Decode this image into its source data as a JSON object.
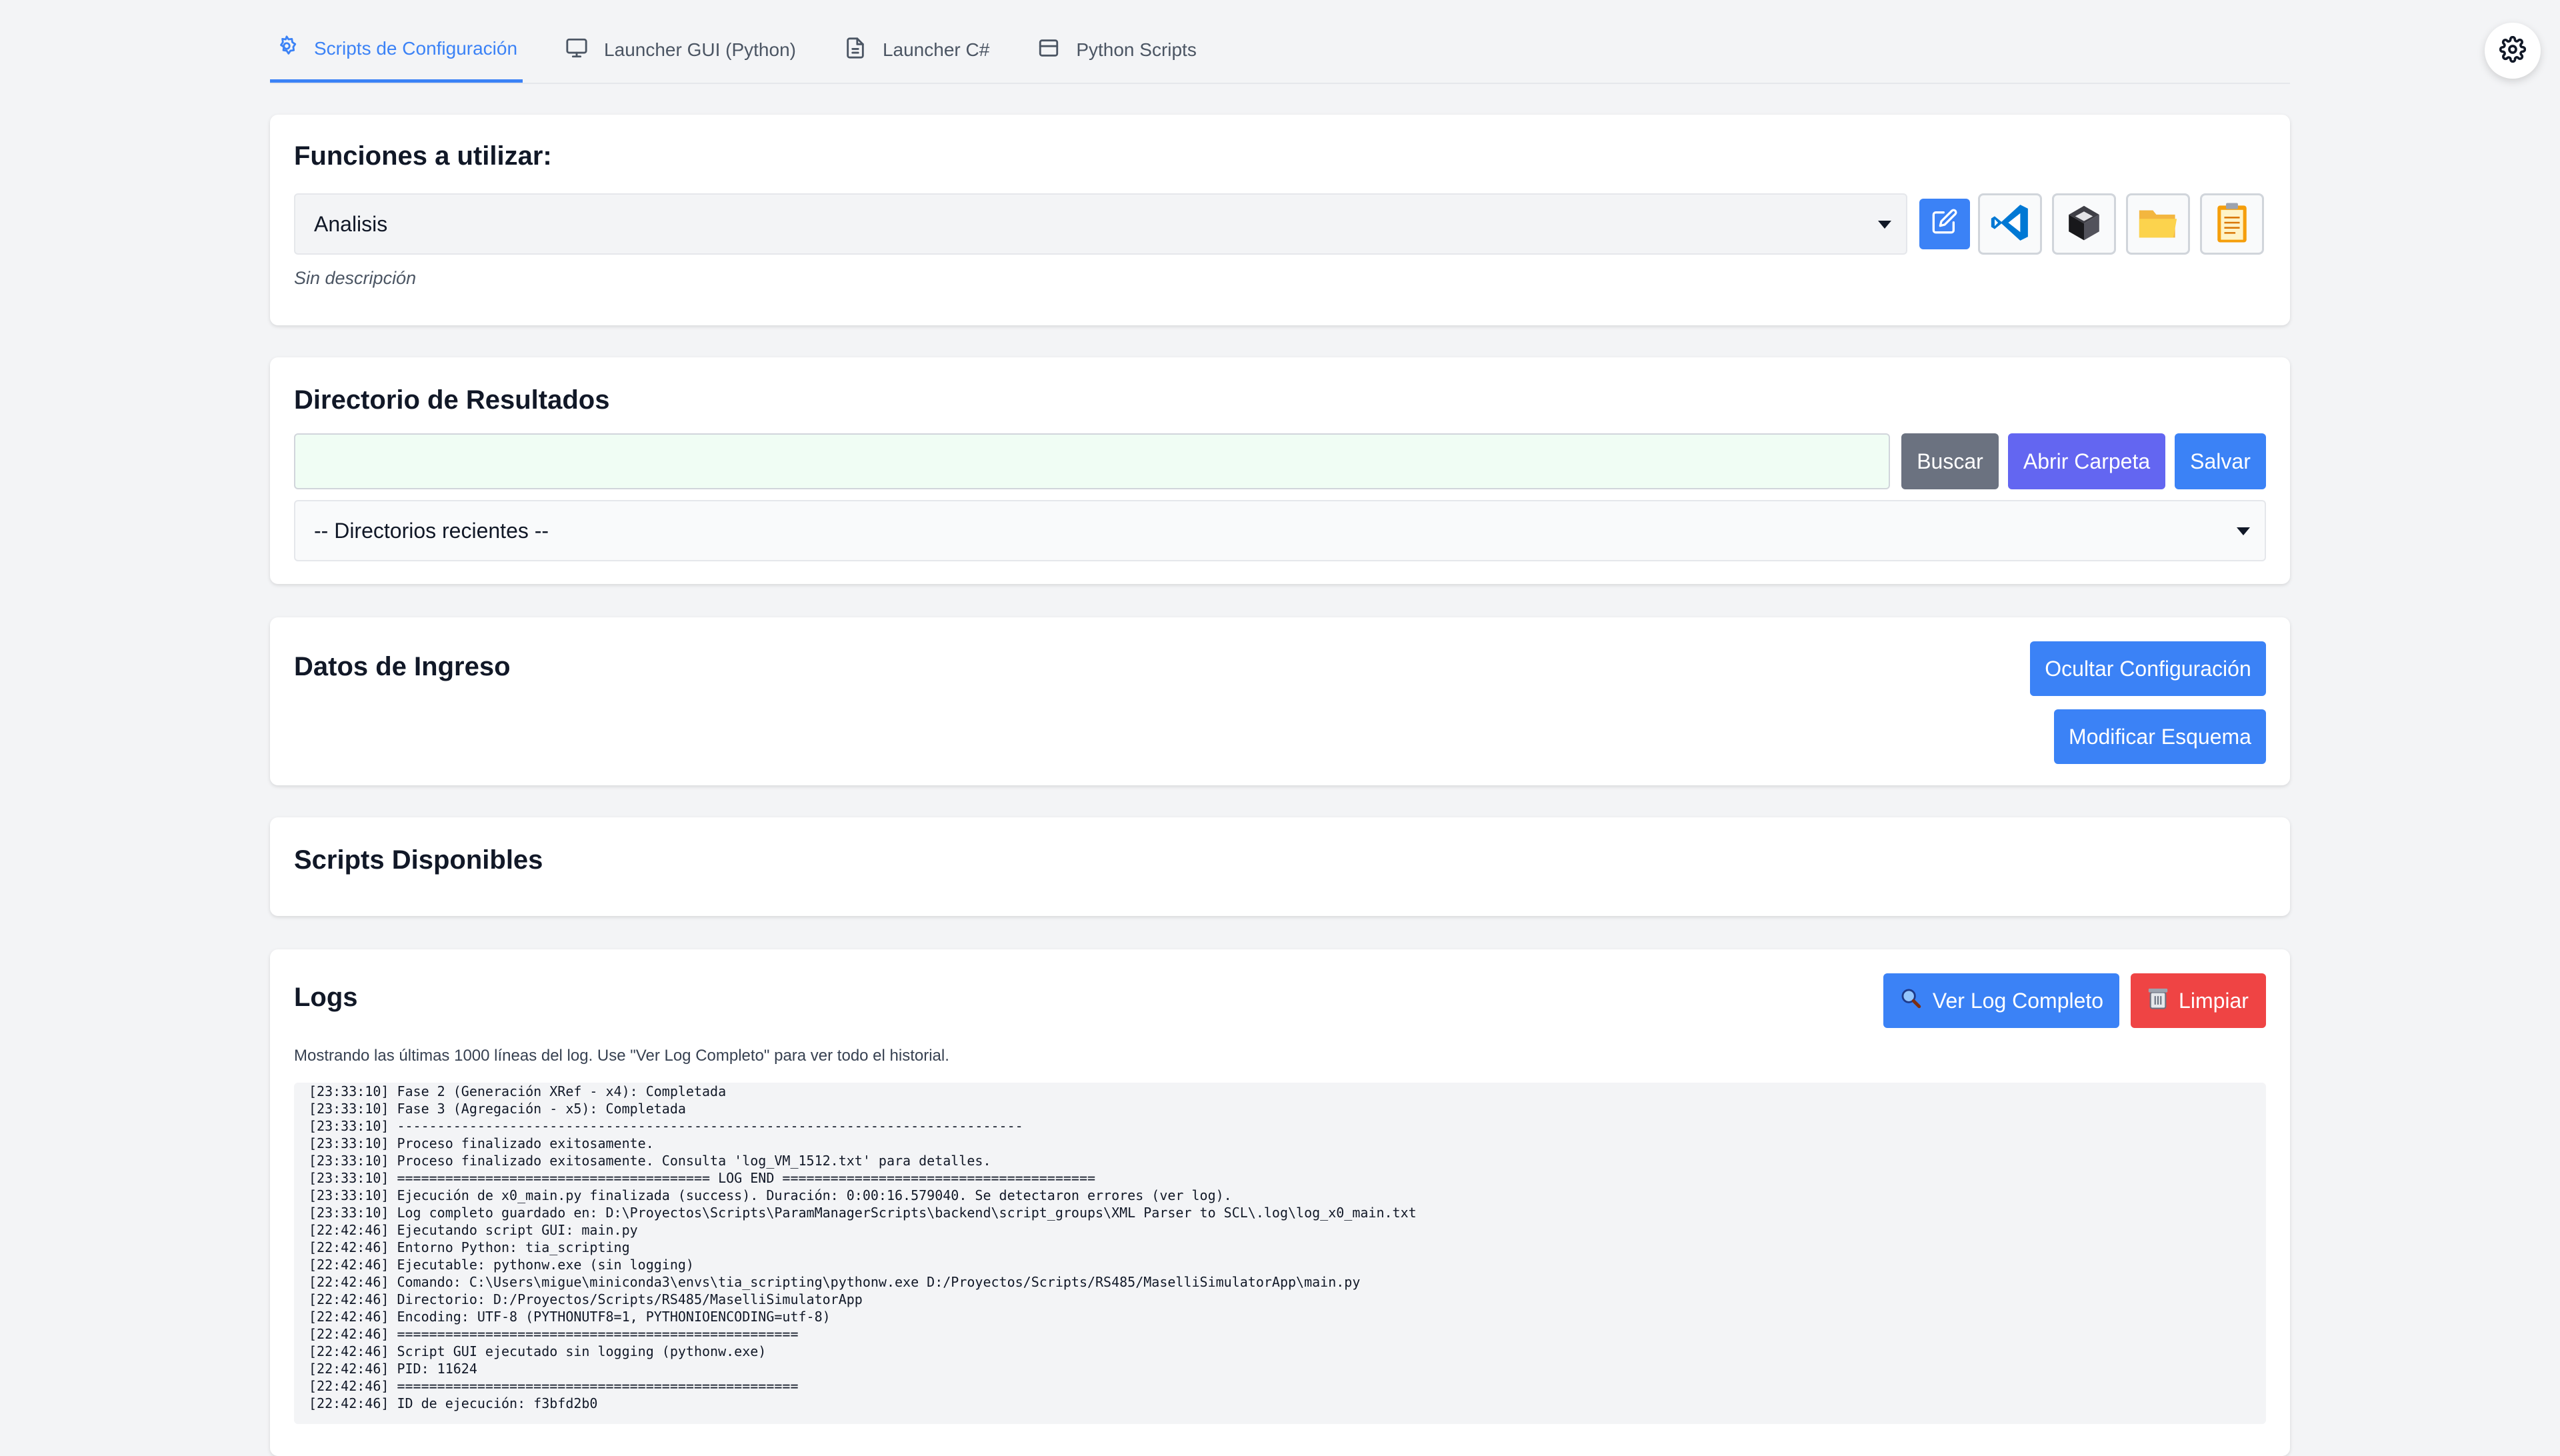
{
  "tabs": [
    {
      "label": "Scripts de Configuración",
      "icon": "gear-icon",
      "active": true
    },
    {
      "label": "Launcher GUI (Python)",
      "icon": "monitor-icon",
      "active": false
    },
    {
      "label": "Launcher C#",
      "icon": "file-icon",
      "active": false
    },
    {
      "label": "Python Scripts",
      "icon": "window-icon",
      "active": false
    }
  ],
  "functions": {
    "title": "Funciones a utilizar:",
    "selected": "Analisis",
    "description": "Sin descripción",
    "tools": [
      "edit-icon",
      "vscode-icon",
      "cursor-icon",
      "folder-icon",
      "clipboard-icon"
    ]
  },
  "results": {
    "title": "Directorio de Resultados",
    "path_value": "",
    "buscar": "Buscar",
    "abrir": "Abrir Carpeta",
    "salvar": "Salvar",
    "recent_placeholder": "-- Directorios recientes --"
  },
  "input": {
    "title": "Datos de Ingreso",
    "hide_config": "Ocultar Configuración",
    "edit_schema": "Modificar Esquema"
  },
  "scripts": {
    "title": "Scripts Disponibles"
  },
  "logs": {
    "title": "Logs",
    "view_full": "Ver Log Completo",
    "clear": "Limpiar",
    "info": "Mostrando las últimas 1000 líneas del log. Use \"Ver Log Completo\" para ver todo el historial.",
    "lines": [
      "[23:33:10] Fase 2 (Generación XRef - x4): Completada",
      "[23:33:10] Fase 3 (Agregación - x5): Completada",
      "[23:33:10] ------------------------------------------------------------------------------",
      "[23:33:10] Proceso finalizado exitosamente.",
      "[23:33:10] Proceso finalizado exitosamente. Consulta 'log_VM_1512.txt' para detalles.",
      "[23:33:10] ======================================= LOG END =======================================",
      "[23:33:10] Ejecución de x0_main.py finalizada (success). Duración: 0:00:16.579040. Se detectaron errores (ver log).",
      "[23:33:10] Log completo guardado en: D:\\Proyectos\\Scripts\\ParamManagerScripts\\backend\\script_groups\\XML Parser to SCL\\.log\\log_x0_main.txt",
      "[22:42:46] Ejecutando script GUI: main.py",
      "[22:42:46] Entorno Python: tia_scripting",
      "[22:42:46] Ejecutable: pythonw.exe (sin logging)",
      "[22:42:46] Comando: C:\\Users\\migue\\miniconda3\\envs\\tia_scripting\\pythonw.exe D:/Proyectos/Scripts/RS485/MaselliSimulatorApp\\main.py",
      "[22:42:46] Directorio: D:/Proyectos/Scripts/RS485/MaselliSimulatorApp",
      "[22:42:46] Encoding: UTF-8 (PYTHONUTF8=1, PYTHONIOENCODING=utf-8)",
      "[22:42:46] ==================================================",
      "[22:42:46] Script GUI ejecutado sin logging (pythonw.exe)",
      "[22:42:46] PID: 11624",
      "[22:42:46] ==================================================",
      "[22:42:46] ID de ejecución: f3bfd2b0"
    ]
  },
  "colors": {
    "primary": "#3b82f6",
    "secondary": "#6b7280",
    "purple": "#6366f1",
    "danger": "#ef4444"
  }
}
